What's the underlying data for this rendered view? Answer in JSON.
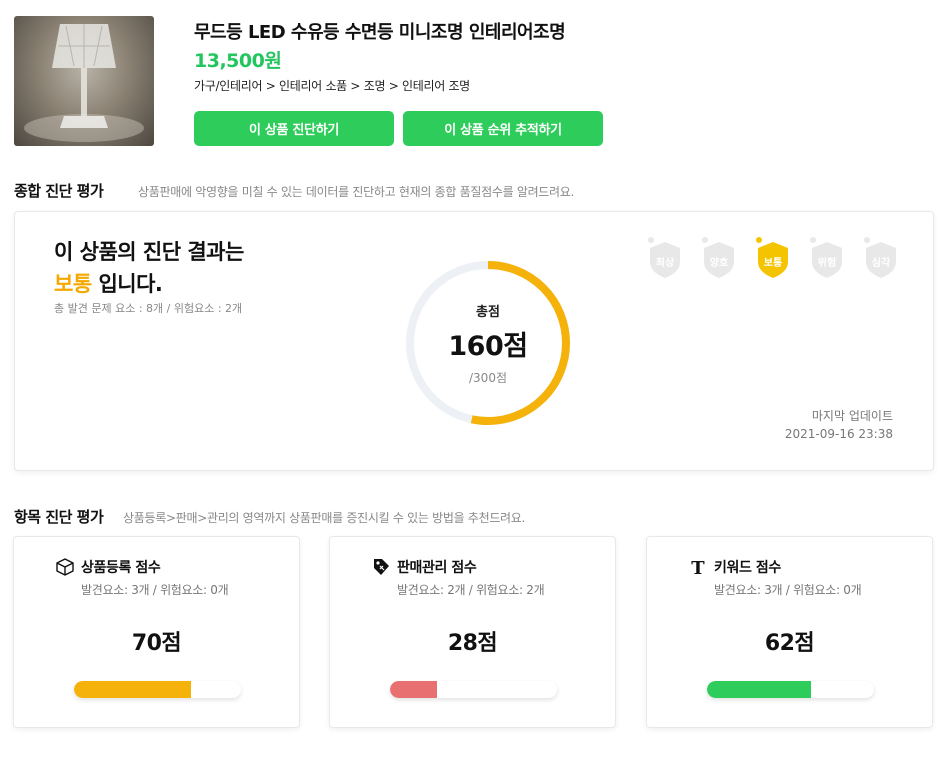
{
  "product": {
    "title": "무드등 LED 수유등 수면등 미니조명 인테리어조명",
    "price": "13,500원",
    "category": "가구/인테리어 > 인테리어 소품 > 조명 > 인테리어 조명",
    "buttons": {
      "diagnose": "이 상품 진단하기",
      "track_rank": "이 상품 순위 추적하기"
    }
  },
  "overall": {
    "section_title": "종합 진단 평가",
    "section_desc": "상품판매에 악영향을 미칠 수 있는 데이터를 진단하고 현재의 종합 품질점수를 알려드려요.",
    "result_line1": "이 상품의 진단 결과는",
    "result_grade": "보통",
    "result_suffix": " 입니다.",
    "issues": "총 발견 문제 요소 : 8개 / 위험요소 : 2개",
    "score_label": "총점",
    "score": "160점",
    "score_max": "/300점",
    "score_value": 160,
    "score_total": 300,
    "grades": [
      {
        "label": "최상",
        "active": false
      },
      {
        "label": "양호",
        "active": false
      },
      {
        "label": "보통",
        "active": true
      },
      {
        "label": "위험",
        "active": false
      },
      {
        "label": "심각",
        "active": false
      }
    ],
    "updated_label": "마지막 업데이트",
    "updated_at": "2021-09-16 23:38"
  },
  "items": {
    "section_title": "항목 진단 평가",
    "section_desc": "상품등록>판매>관리의 영역까지 상품판매를 증진시킬 수 있는 방법을 추천드려요.",
    "cards": [
      {
        "icon": "box-icon",
        "title": "상품등록 점수",
        "sub": "발견요소: 3개 / 위험요소: 0개",
        "score": "70점",
        "progress": 0.7,
        "color": "#f5b20b"
      },
      {
        "icon": "price-tag-icon",
        "title": "판매관리 점수",
        "sub": "발견요소: 2개 / 위험요소: 2개",
        "score": "28점",
        "progress": 0.28,
        "color": "#e87070"
      },
      {
        "icon": "text-t-icon",
        "title": "키워드 점수",
        "sub": "발견요소: 3개 / 위험요소: 0개",
        "score": "62점",
        "progress": 0.62,
        "color": "#2ecc5a"
      }
    ]
  },
  "colors": {
    "accent_green": "#2ecc5a",
    "grade_yellow": "#f5a800",
    "donut_track": "#edf0f5",
    "donut_fill": "#f5b20b",
    "shield_inactive": "#e8e8e8",
    "shield_active": "#f5c400"
  }
}
